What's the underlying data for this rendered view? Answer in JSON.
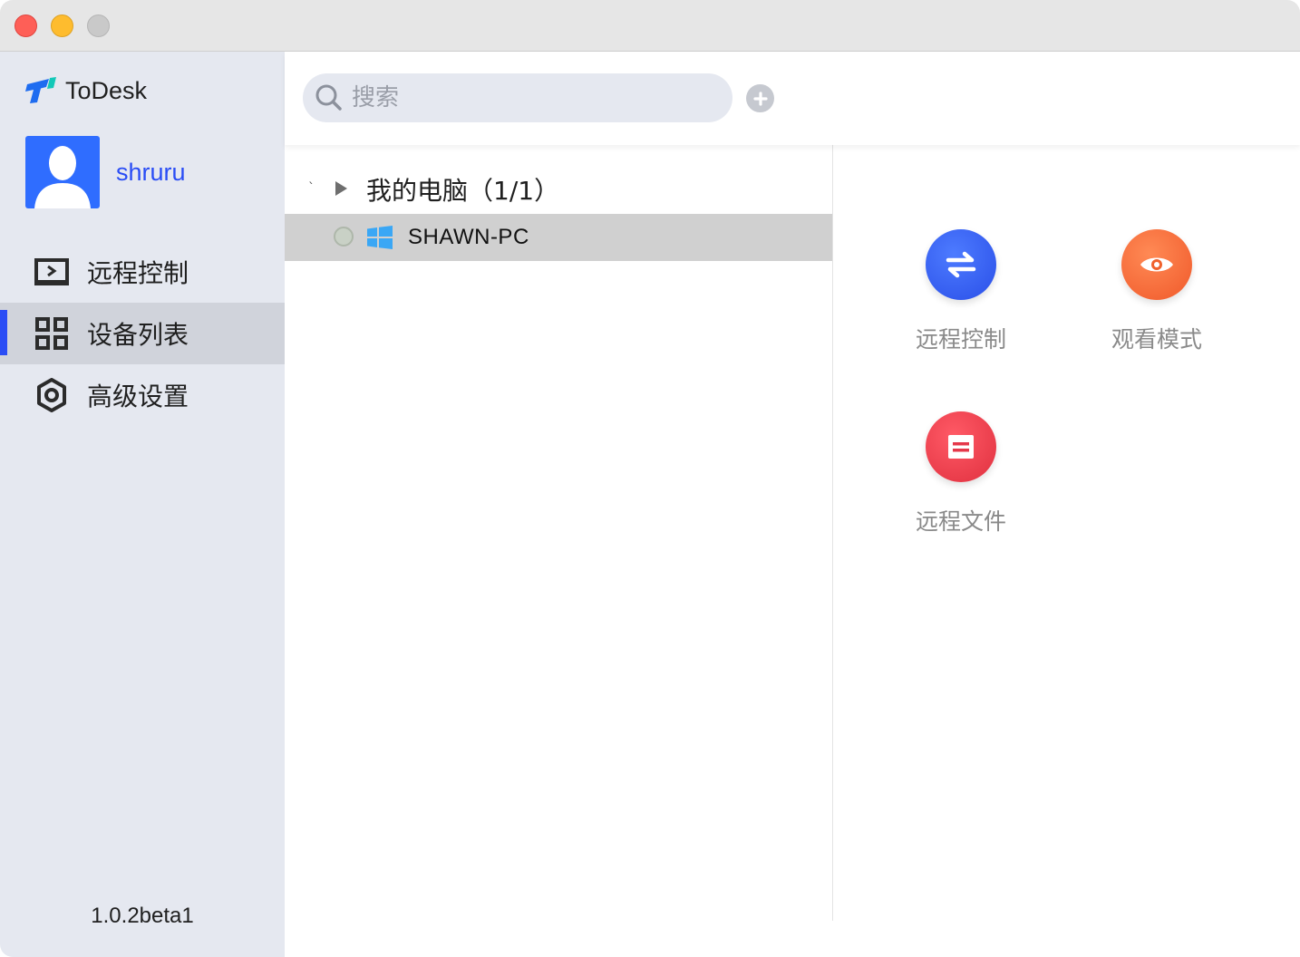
{
  "window": {
    "controls": [
      "close",
      "minimize",
      "maximize"
    ]
  },
  "sidebar": {
    "brand": {
      "name": "ToDesk",
      "icon": "todesk-logo-icon"
    },
    "user": {
      "name": "shruru",
      "avatar_icon": "user-avatar-icon"
    },
    "items": [
      {
        "label": "远程控制",
        "icon": "remote-screen-icon",
        "active": false
      },
      {
        "label": "设备列表",
        "icon": "grid-icon",
        "active": true
      },
      {
        "label": "高级设置",
        "icon": "gear-icon",
        "active": false
      }
    ],
    "version": "1.0.2beta1"
  },
  "search": {
    "placeholder": "搜索",
    "value": ""
  },
  "device_list": {
    "group": {
      "label": "我的电脑（1/1）",
      "expanded": true
    },
    "devices": [
      {
        "name": "SHAWN-PC",
        "os": "windows-icon",
        "status": "offline",
        "selected": true
      }
    ]
  },
  "actions": {
    "remote_control": {
      "label": "远程控制",
      "icon": "swap-arrows-icon",
      "color": "#2f59f0"
    },
    "view_mode": {
      "label": "观看模式",
      "icon": "eye-icon",
      "color": "#f56a35"
    },
    "remote_file": {
      "label": "远程文件",
      "icon": "file-icon",
      "color": "#e8394a"
    }
  },
  "colors": {
    "accent": "#2a4df5",
    "sidebar_bg": "#e5e8f0",
    "selected_row": "#d0d0d0"
  }
}
